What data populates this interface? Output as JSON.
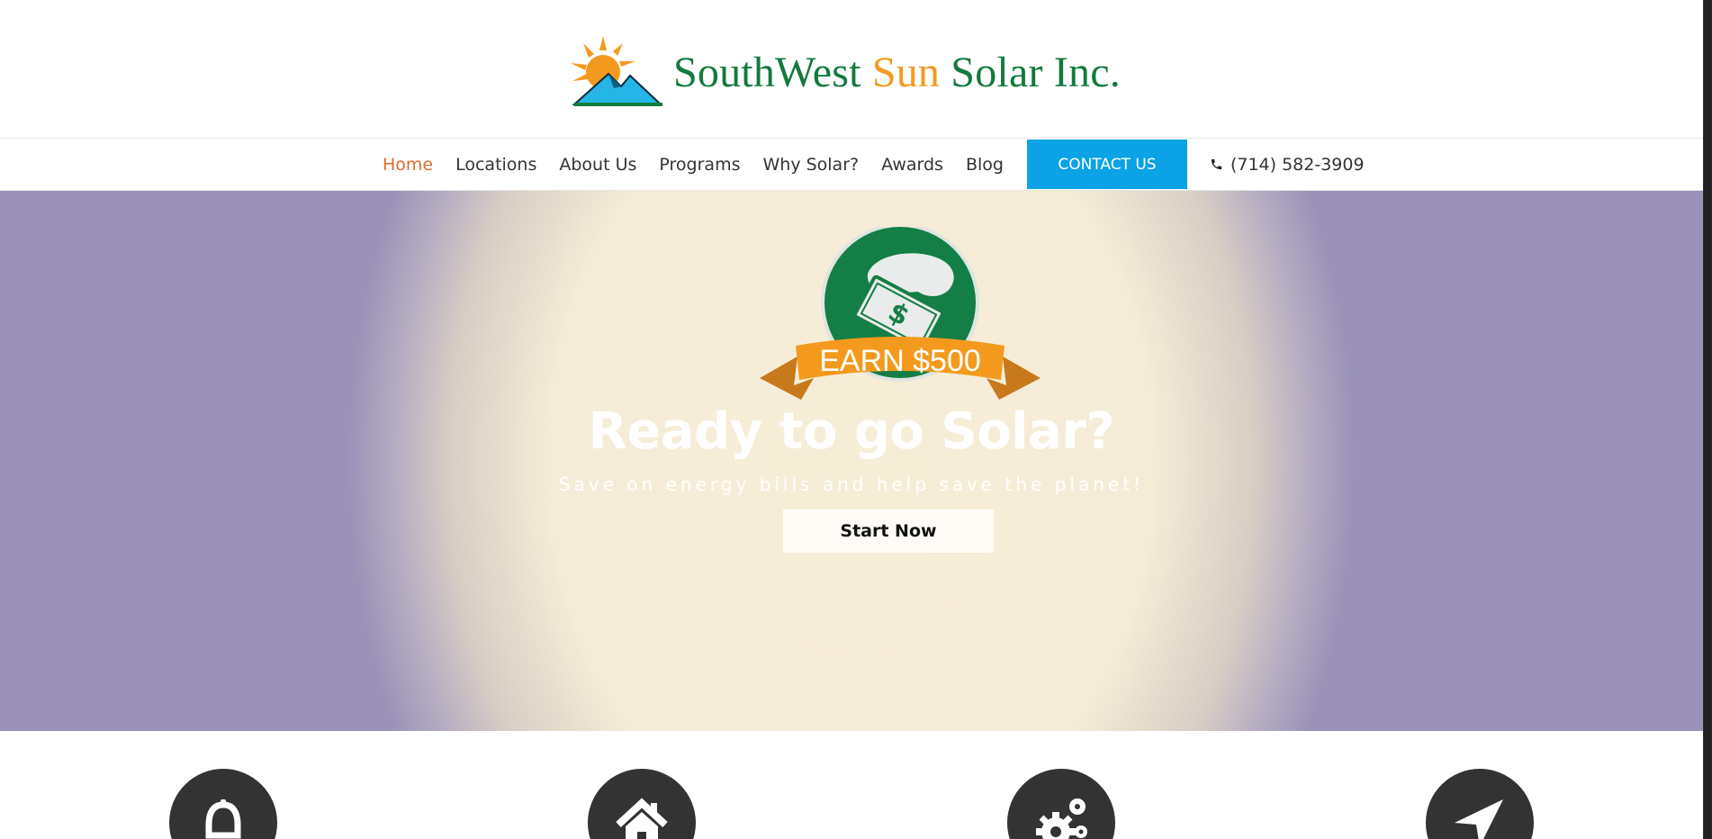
{
  "brand": {
    "name_part1": "SouthWest ",
    "name_part2": "Sun",
    "name_part3": " Solar Inc.",
    "colors": {
      "green": "#127a3e",
      "orange": "#f39a1e",
      "blue": "#0ba2e6"
    }
  },
  "nav": {
    "items": [
      {
        "label": "Home",
        "active": true
      },
      {
        "label": "Locations"
      },
      {
        "label": "About Us"
      },
      {
        "label": "Programs"
      },
      {
        "label": "Why Solar?"
      },
      {
        "label": "Awards"
      },
      {
        "label": "Blog"
      }
    ],
    "contact_label": "CONTACT US",
    "phone": "(714) 582-3909",
    "phone_icon": "phone-icon"
  },
  "hero": {
    "badge_text": "EARN $500",
    "badge_symbol": "$",
    "title": "Ready to go Solar?",
    "subtitle": "Save on energy bills and help save the planet!",
    "cta_label": "Start Now"
  },
  "features": {
    "icons": [
      "bell-icon",
      "home-icon",
      "gears-icon",
      "location-arrow-icon"
    ]
  }
}
